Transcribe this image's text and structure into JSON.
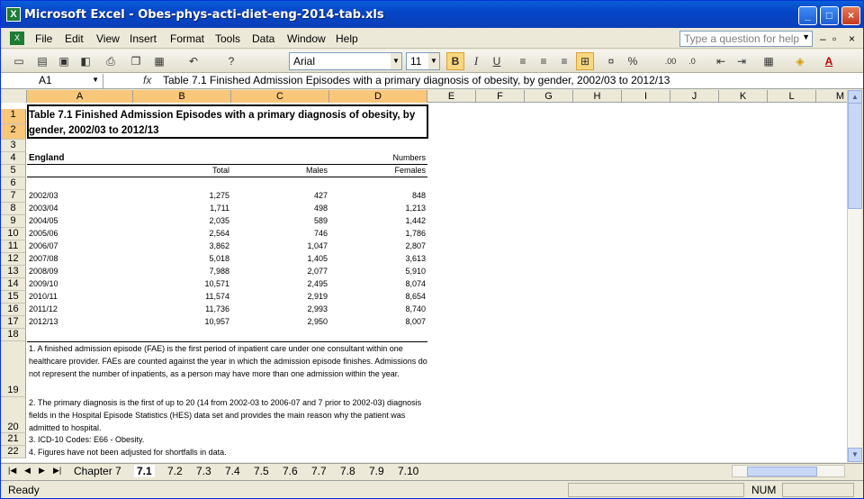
{
  "window": {
    "title": "Microsoft Excel - Obes-phys-acti-diet-eng-2014-tab.xls",
    "min": "_",
    "max": "□",
    "close": "×"
  },
  "menu": [
    "File",
    "Edit",
    "View",
    "Insert",
    "Format",
    "Tools",
    "Data",
    "Window",
    "Help"
  ],
  "help_placeholder": "Type a question for help",
  "font": {
    "name": "Arial",
    "size": "11"
  },
  "toolbar_text": {
    "bold": "B",
    "italic": "I",
    "underline": "U",
    "percent": "%",
    "inc_dec": ".00",
    "dec_dec": ".0"
  },
  "namebox": "A1",
  "fx": "fx",
  "formula": "Table 7.1 Finished Admission Episodes with a primary diagnosis of obesity, by gender, 2002/03 to 2012/13",
  "columns": [
    "A",
    "B",
    "C",
    "D",
    "E",
    "F",
    "G",
    "H",
    "I",
    "J",
    "K",
    "L",
    "M"
  ],
  "rows": [
    "1",
    "2",
    "3",
    "4",
    "5",
    "6",
    "7",
    "8",
    "9",
    "10",
    "11",
    "12",
    "13",
    "14",
    "15",
    "16",
    "17",
    "18",
    "19",
    "20",
    "21",
    "22"
  ],
  "sheet": {
    "title_line1": "Table 7.1 Finished Admission Episodes with a primary diagnosis of obesity, by",
    "title_line2": "gender, 2002/03 to 2012/13",
    "region": "England",
    "units": "Numbers",
    "headers": [
      "Total",
      "Males",
      "Females"
    ],
    "data": [
      [
        "2002/03",
        "1,275",
        "427",
        "848"
      ],
      [
        "2003/04",
        "1,711",
        "498",
        "1,213"
      ],
      [
        "2004/05",
        "2,035",
        "589",
        "1,442"
      ],
      [
        "2005/06",
        "2,564",
        "746",
        "1,786"
      ],
      [
        "2006/07",
        "3,862",
        "1,047",
        "2,807"
      ],
      [
        "2007/08",
        "5,018",
        "1,405",
        "3,613"
      ],
      [
        "2008/09",
        "7,988",
        "2,077",
        "5,910"
      ],
      [
        "2009/10",
        "10,571",
        "2,495",
        "8,074"
      ],
      [
        "2010/11",
        "11,574",
        "2,919",
        "8,654"
      ],
      [
        "2011/12",
        "11,736",
        "2,993",
        "8,740"
      ],
      [
        "2012/13",
        "10,957",
        "2,950",
        "8,007"
      ]
    ],
    "note1": "1. A finished admission episode (FAE) is the first period of inpatient care under one consultant within one healthcare provider. FAEs are counted against the year in which the admission episode finishes. Admissions do not represent the number of inpatients, as a person may have more than one admission within the year.",
    "note2": "2. The primary diagnosis is the first of up to 20 (14 from 2002-03 to 2006-07 and 7 prior to 2002-03) diagnosis fields in the Hospital Episode Statistics (HES) data set and provides the main reason why the patient was admitted to hospital.",
    "note3": "3. ICD-10 Codes: E66 - Obesity.",
    "note4": "4. Figures have not been adjusted for shortfalls in data."
  },
  "tabs": [
    "Chapter 7",
    "7.1",
    "7.2",
    "7.3",
    "7.4",
    "7.5",
    "7.6",
    "7.7",
    "7.8",
    "7.9",
    "7.10"
  ],
  "active_tab": "7.1",
  "status": {
    "left": "Ready",
    "num": "NUM"
  }
}
